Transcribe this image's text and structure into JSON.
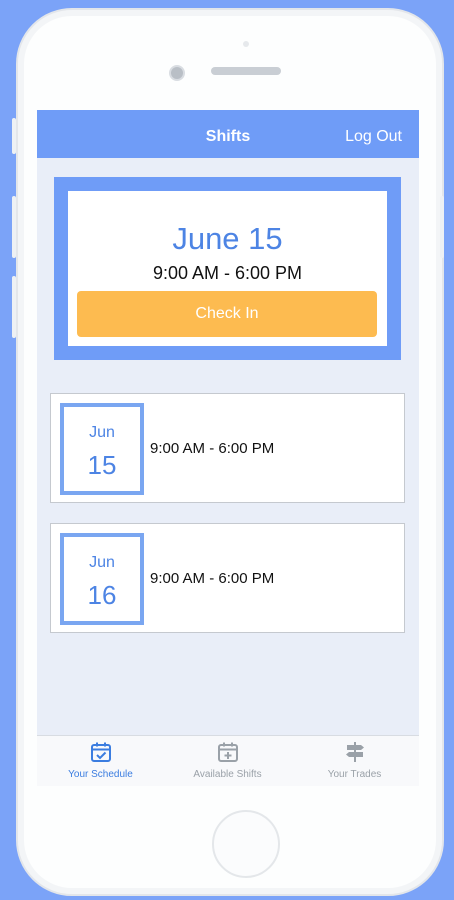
{
  "navbar": {
    "title": "Shifts",
    "logout_label": "Log Out"
  },
  "current_shift": {
    "date": "June 15",
    "time": "9:00 AM - 6:00 PM",
    "check_in_label": "Check In"
  },
  "shifts": [
    {
      "month": "Jun",
      "day": "15",
      "time": "9:00 AM - 6:00 PM"
    },
    {
      "month": "Jun",
      "day": "16",
      "time": "9:00 AM - 6:00 PM"
    }
  ],
  "tabs": [
    {
      "label": "Your Schedule",
      "icon": "calendar-check-icon",
      "active": true
    },
    {
      "label": "Available Shifts",
      "icon": "calendar-plus-icon",
      "active": false
    },
    {
      "label": "Your Trades",
      "icon": "signpost-icon",
      "active": false
    }
  ],
  "colors": {
    "background": "#7ba3f8",
    "primary": "#6f9cf7",
    "accent_text": "#4d84e4",
    "check_in_button": "#fdbb50",
    "tab_active": "#3b7de0",
    "tab_inactive": "#9aa1a8"
  }
}
